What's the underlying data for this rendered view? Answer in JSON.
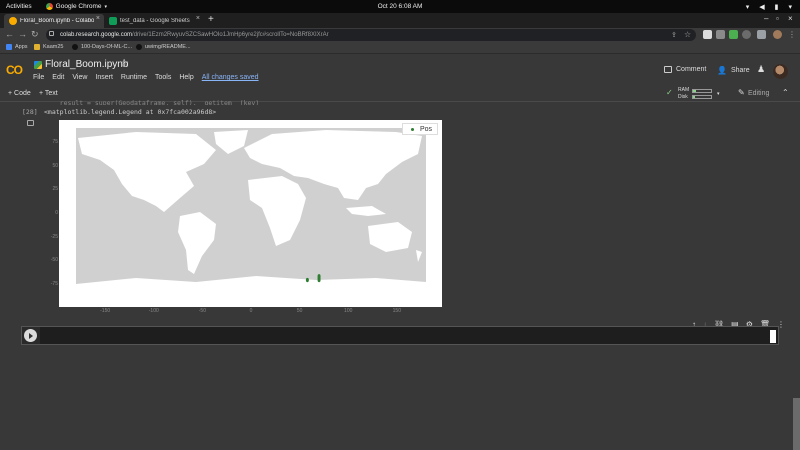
{
  "system_bar": {
    "activities": "Activities",
    "app_name": "Google Chrome",
    "clock": "Oct 20  6:08 AM"
  },
  "tabs": [
    {
      "title": "Floral_Boom.ipynb - Colabora",
      "active": true
    },
    {
      "title": "test_data - Google Sheets",
      "active": false
    }
  ],
  "address": {
    "host": "colab.research.google.com",
    "path": "/drive/1Ezm2RwyuvSZCSawHOIo1JmHp6yre2jfc#scrollTo=NoBRf8XIXrAr"
  },
  "bookmarks": [
    {
      "label": "Apps",
      "color": "#4285f4"
    },
    {
      "label": "Kaam25",
      "color": "#e0b030"
    },
    {
      "label": "100-Days-Of-ML-C...",
      "color": "#888888"
    },
    {
      "label": "uwimg/README...",
      "color": "#888888"
    }
  ],
  "colab": {
    "logo": "CO",
    "notebook_title": "Floral_Boom.ipynb",
    "menus": [
      "File",
      "Edit",
      "View",
      "Insert",
      "Runtime",
      "Tools",
      "Help"
    ],
    "save_status": "All changes saved",
    "comment_label": "Comment",
    "share_label": "Share"
  },
  "toolbar": {
    "add_code": "+ Code",
    "add_text": "+ Text",
    "ram_label": "RAM",
    "disk_label": "Disk",
    "ram_fill": 0.15,
    "disk_fill": 0.1,
    "editing_label": "Editing"
  },
  "cell": {
    "previous_line": "    result = super(Geodataframe, self).__getitem__(key)",
    "exec_count": "[28]",
    "output_text": "<matplotlib.legend.Legend at 0x7fca002a96d8>"
  },
  "chart_data": {
    "type": "scatter",
    "title": "",
    "xlabel": "",
    "ylabel": "",
    "xlim": [
      -180,
      180
    ],
    "ylim": [
      -90,
      90
    ],
    "x_ticks": [
      "-150",
      "-100",
      "-50",
      "0",
      "50",
      "100",
      "150"
    ],
    "y_ticks": [
      "75",
      "50",
      "25",
      "0",
      "-25",
      "-50",
      "-75"
    ],
    "legend": {
      "position": "top-right",
      "entries": [
        "Pos"
      ]
    },
    "series": [
      {
        "name": "Pos",
        "color": "#2e7d32",
        "points": [
          {
            "x": 70,
            "y": -67
          },
          {
            "x": 70,
            "y": -69
          },
          {
            "x": 70,
            "y": -71
          },
          {
            "x": 58,
            "y": -71
          }
        ]
      }
    ]
  }
}
